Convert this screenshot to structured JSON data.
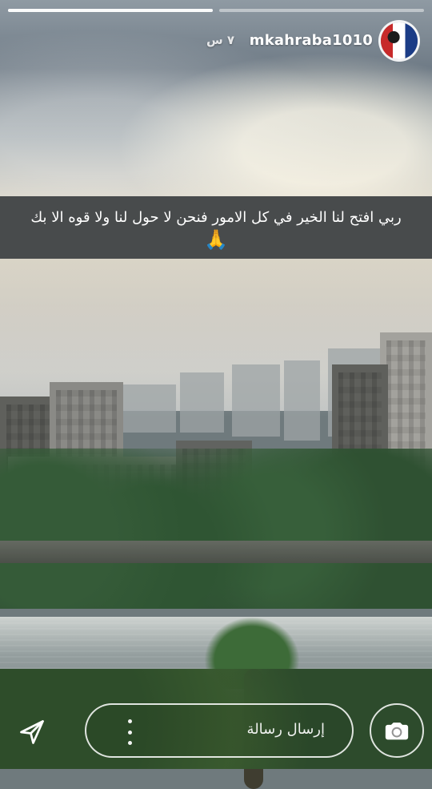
{
  "story": {
    "username": "mkahraba1010",
    "time": "٧ س",
    "progress": [
      {
        "fill": 100
      },
      {
        "fill": 0
      }
    ],
    "caption": "ربي افتح لنا الخير في كل الامور فنحن لا حول لنا ولا قوه الا بك",
    "caption_emoji": "🙏",
    "message_placeholder": "إرسال رسالة",
    "icons": {
      "send": "send-icon",
      "more": "more-options-icon",
      "camera": "camera-icon"
    }
  }
}
